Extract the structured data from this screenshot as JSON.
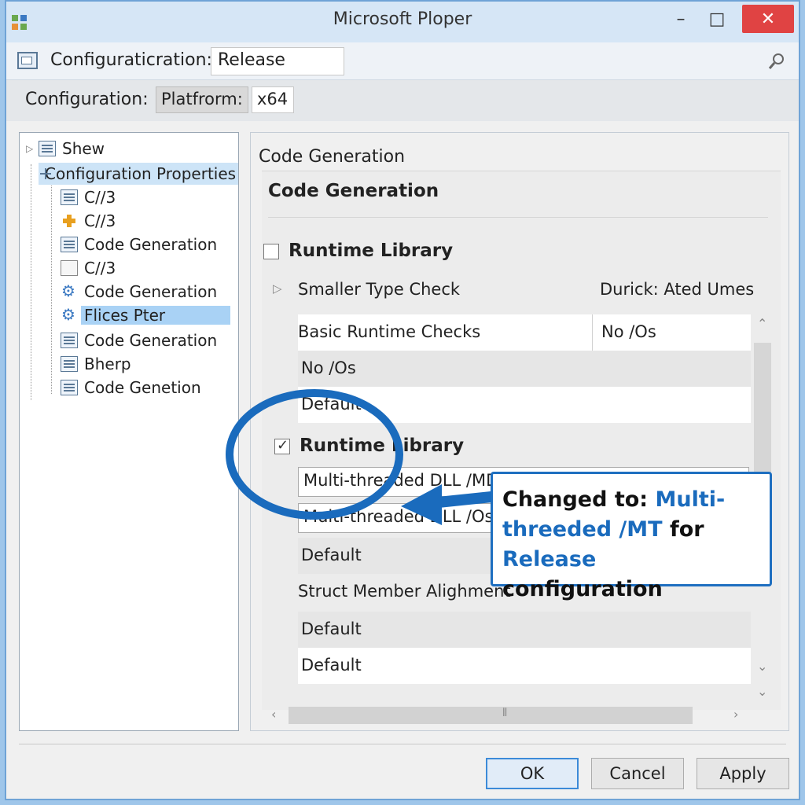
{
  "window": {
    "title": "Microsoft Ploper",
    "minimize": "–",
    "maximize": "□",
    "close": "✕"
  },
  "toolbar1": {
    "label": "Configuraticration:",
    "value": "Release"
  },
  "toolbar2": {
    "label": "Configuration:",
    "platform_label": "Platfrorm:",
    "platform_value": "x64"
  },
  "tree": {
    "items": [
      {
        "label": "Shew"
      },
      {
        "label": "Configuration Properties"
      },
      {
        "label": "C//3"
      },
      {
        "label": "C//3"
      },
      {
        "label": "Code Generation"
      },
      {
        "label": "C//3"
      },
      {
        "label": "Code Generation"
      },
      {
        "label": "Flices Pter"
      },
      {
        "label": "Code Generation"
      },
      {
        "label": "Bherp"
      },
      {
        "label": "Code Genetion"
      }
    ]
  },
  "right": {
    "section_title": "Code Generation",
    "panel_heading": "Code Generation",
    "runtime_library_1": "Runtime Library",
    "smaller_type_check": {
      "label": "Smaller Type Check",
      "value": "Durick: Ated Umes"
    },
    "basic_runtime_checks": {
      "label": "Basic Runtime Checks",
      "value": "No /Os"
    },
    "rows_a": [
      "No /Os",
      "Default"
    ],
    "runtime_library_2": "Runtime Library",
    "combo_1": "Multi-threaded DLL /MD",
    "combo_2": "Multi-threaded DLL /Os",
    "default_after_combo": "Default",
    "struct_member_alignment": "Struct Member Alighment",
    "rows_b": [
      "Default",
      "Default"
    ],
    "hscroll_grip": "⦀"
  },
  "callout": {
    "part1": "Changed to: ",
    "part2": "Multi-threeded /MT",
    "part3": " for ",
    "part4": "Release",
    "part5": " configuration"
  },
  "buttons": {
    "ok": "OK",
    "cancel": "Cancel",
    "apply": "Apply"
  },
  "colors": {
    "accent": "#1e6fc0",
    "selection": "#a9d2f5",
    "close": "#e04343"
  },
  "icons": [
    "app-icon",
    "search-icon",
    "toolbar-config-icon",
    "tree-doc-icon",
    "tree-plus-icon",
    "tree-folder-icon",
    "tree-gear-icon",
    "callout-arrow-icon",
    "highlight-circle"
  ]
}
